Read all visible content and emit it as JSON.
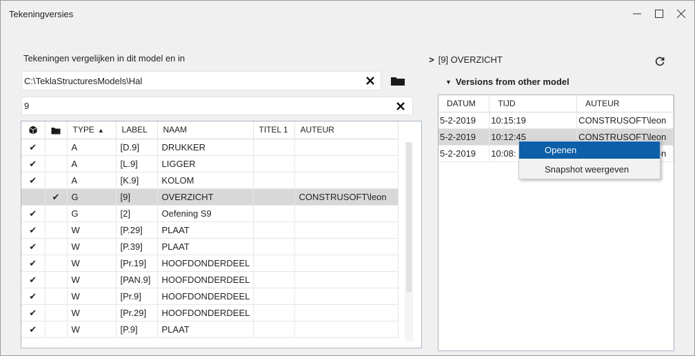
{
  "window": {
    "title": "Tekeningversies",
    "minimize_icon": "minimize-icon",
    "maximize_icon": "maximize-icon",
    "close_icon": "close-icon"
  },
  "left": {
    "compare_label": "Tekeningen vergelijken in dit model en in",
    "path_value": "C:\\TeklaStructuresModels\\Hal",
    "filter_value": "9",
    "table": {
      "headers": {
        "model_icon": "cube-icon",
        "folder_icon": "folder-icon",
        "type": "TYPE",
        "label": "LABEL",
        "naam": "NAAM",
        "titel1": "TITEL 1",
        "auteur": "AUTEUR"
      },
      "rows": [
        {
          "c1": "✔",
          "c2": "",
          "type": "A",
          "label": "[D.9]",
          "naam": "DRUKKER",
          "titel1": "",
          "auteur": ""
        },
        {
          "c1": "✔",
          "c2": "",
          "type": "A",
          "label": "[L.9]",
          "naam": "LIGGER",
          "titel1": "",
          "auteur": ""
        },
        {
          "c1": "✔",
          "c2": "",
          "type": "A",
          "label": "[K.9]",
          "naam": "KOLOM",
          "titel1": "",
          "auteur": ""
        },
        {
          "c1": "",
          "c2": "✔",
          "type": "G",
          "label": "[9]",
          "naam": "OVERZICHT",
          "titel1": "",
          "auteur": "CONSTRUSOFT\\leon"
        },
        {
          "c1": "✔",
          "c2": "",
          "type": "G",
          "label": "[2]",
          "naam": "Oefening S9",
          "titel1": "",
          "auteur": ""
        },
        {
          "c1": "✔",
          "c2": "",
          "type": "W",
          "label": "[P.29]",
          "naam": "PLAAT",
          "titel1": "",
          "auteur": ""
        },
        {
          "c1": "✔",
          "c2": "",
          "type": "W",
          "label": "[P.39]",
          "naam": "PLAAT",
          "titel1": "",
          "auteur": ""
        },
        {
          "c1": "✔",
          "c2": "",
          "type": "W",
          "label": "[Pr.19]",
          "naam": "HOOFDONDERDEEL",
          "titel1": "",
          "auteur": ""
        },
        {
          "c1": "✔",
          "c2": "",
          "type": "W",
          "label": "[PAN.9]",
          "naam": "HOOFDONDERDEEL",
          "titel1": "",
          "auteur": ""
        },
        {
          "c1": "✔",
          "c2": "",
          "type": "W",
          "label": "[Pr.9]",
          "naam": "HOOFDONDERDEEL",
          "titel1": "",
          "auteur": ""
        },
        {
          "c1": "✔",
          "c2": "",
          "type": "W",
          "label": "[Pr.29]",
          "naam": "HOOFDONDERDEEL",
          "titel1": "",
          "auteur": ""
        },
        {
          "c1": "✔",
          "c2": "",
          "type": "W",
          "label": "[P.9]",
          "naam": "PLAAT",
          "titel1": "",
          "auteur": ""
        }
      ]
    }
  },
  "right": {
    "drawing_title": "[9] OVERZICHT",
    "versions_title": "Versions from other model",
    "table": {
      "headers": {
        "datum": "DATUM",
        "tijd": "TIJD",
        "auteur": "AUTEUR"
      },
      "rows": [
        {
          "datum": "5-2-2019",
          "tijd": "10:15:19",
          "auteur": "CONSTRUSOFT\\leon"
        },
        {
          "datum": "5-2-2019",
          "tijd": "10:12:45",
          "auteur": "CONSTRUSOFT\\leon"
        },
        {
          "datum": "5-2-2019",
          "tijd": "10:08:",
          "auteur": "CONSTRUSOFT\\leon"
        }
      ]
    }
  },
  "context_menu": {
    "open": "Openen",
    "snapshot": "Snapshot weergeven"
  },
  "colors": {
    "selection_bg": "#d8d8d8",
    "menu_highlight": "#0d5fa8"
  }
}
